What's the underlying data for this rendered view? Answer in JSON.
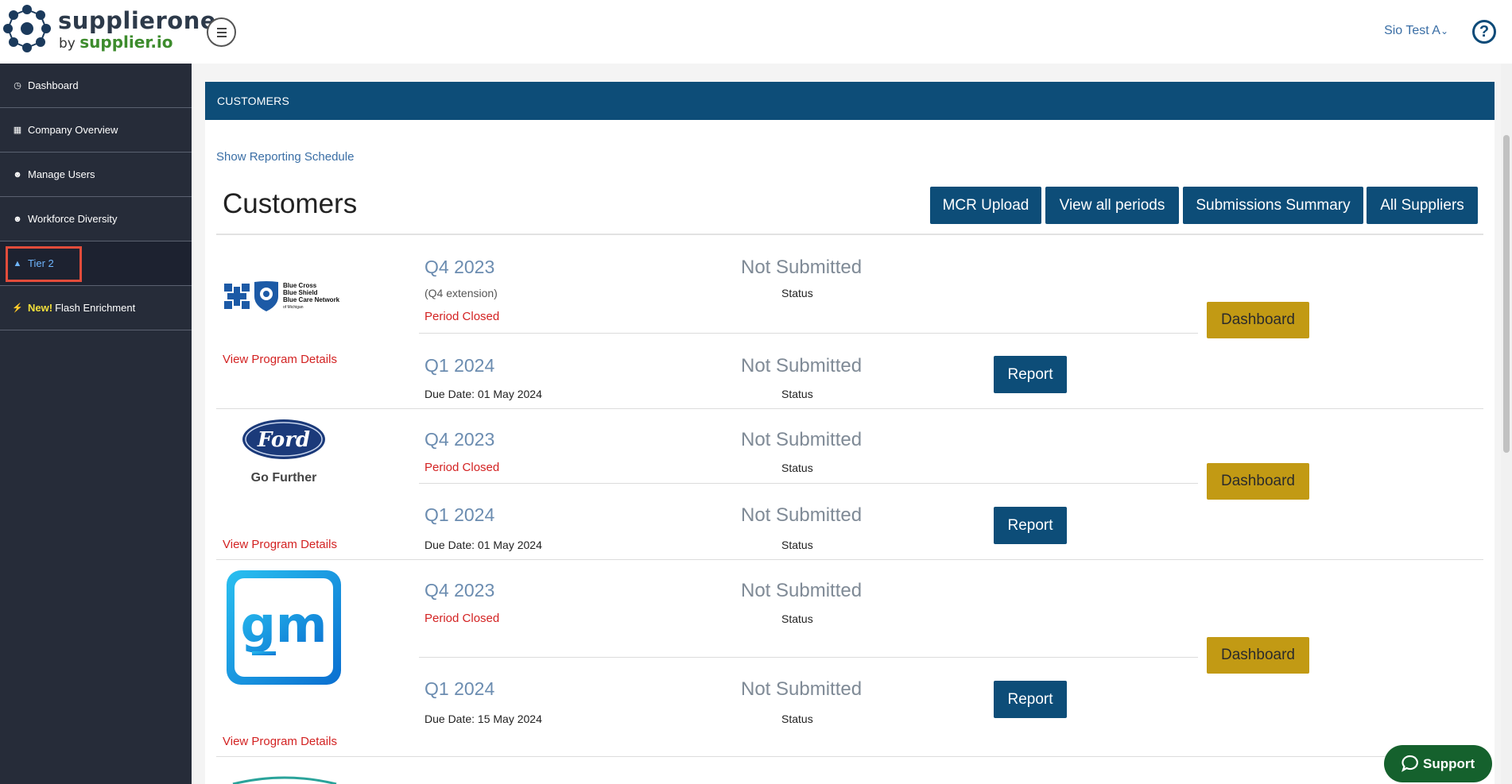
{
  "brand": {
    "name": "supplierone",
    "by": "by",
    "sub": "supplier.io",
    "colors": {
      "primary": "#0d4d78",
      "accent_gold": "#c29a14",
      "alert_red": "#d32222",
      "brand_green": "#3d8c2d"
    }
  },
  "header": {
    "menu_icon": "hamburger-icon",
    "user": "Sio Test A",
    "user_icon": "chevron-down-icon",
    "help_icon": "help-circle-icon",
    "help_glyph": "?"
  },
  "sidebar": {
    "items": [
      {
        "label": "Dashboard",
        "icon": "dashboard-icon"
      },
      {
        "label": "Company Overview",
        "icon": "building-icon"
      },
      {
        "label": "Manage Users",
        "icon": "users-icon"
      },
      {
        "label": "Workforce Diversity",
        "icon": "users-icon"
      },
      {
        "label": "Tier 2",
        "icon": "org-chart-icon",
        "active": true
      },
      {
        "badge": "New!",
        "label": "Flash Enrichment",
        "icon": "lightning-icon"
      }
    ]
  },
  "main": {
    "panel_title": "CUSTOMERS",
    "show_schedule": "Show Reporting Schedule",
    "title": "Customers",
    "buttons": {
      "mcr_upload": "MCR Upload",
      "view_all_periods": "View all periods",
      "submissions_summary": "Submissions Summary",
      "all_suppliers": "All Suppliers"
    },
    "customers": [
      {
        "logo_name": "Blue Cross Blue Shield Blue Care Network",
        "logo_text": [
          "Blue Cross",
          "Blue Shield",
          "Blue Care Network",
          "of Michigan"
        ],
        "view_details": "View Program Details",
        "dashboard": "Dashboard",
        "periods": [
          {
            "period": "Q4 2023",
            "extension": "(Q4 extension)",
            "note": "Period Closed",
            "status": "Not Submitted",
            "status_label": "Status"
          },
          {
            "period": "Q1 2024",
            "due": "Due Date: 01 May 2024",
            "status": "Not Submitted",
            "status_label": "Status",
            "action": "Report"
          }
        ]
      },
      {
        "logo_name": "Ford",
        "logo_tagline": "Go Further",
        "view_details": "View Program Details",
        "dashboard": "Dashboard",
        "periods": [
          {
            "period": "Q4 2023",
            "note": "Period Closed",
            "status": "Not Submitted",
            "status_label": "Status"
          },
          {
            "period": "Q1 2024",
            "due": "Due Date: 01 May 2024",
            "status": "Not Submitted",
            "status_label": "Status",
            "action": "Report"
          }
        ]
      },
      {
        "logo_name": "gm",
        "view_details": "View Program Details",
        "dashboard": "Dashboard",
        "periods": [
          {
            "period": "Q4 2023",
            "note": "Period Closed",
            "status": "Not Submitted",
            "status_label": "Status"
          },
          {
            "period": "Q1 2024",
            "due": "Due Date: 15 May 2024",
            "status": "Not Submitted",
            "status_label": "Status",
            "action": "Report"
          }
        ]
      }
    ]
  },
  "support": {
    "label": "Support",
    "icon": "chat-icon"
  }
}
